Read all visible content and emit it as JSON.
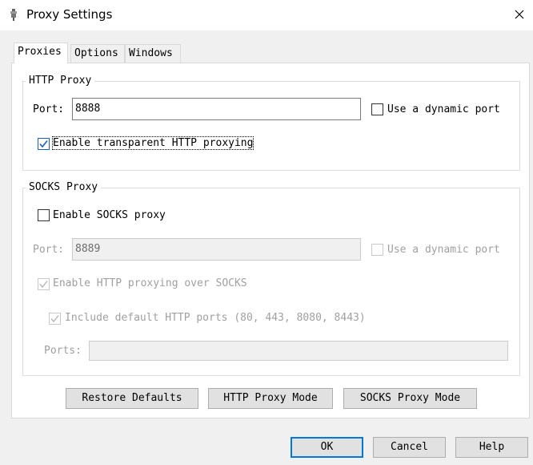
{
  "window": {
    "title": "Proxy Settings",
    "icon": "proxy-app-icon",
    "close_icon": "close-icon"
  },
  "tabs": [
    {
      "label": "Proxies",
      "active": true
    },
    {
      "label": "Options",
      "active": false
    },
    {
      "label": "Windows",
      "active": false
    }
  ],
  "http_proxy": {
    "group_label": "HTTP Proxy",
    "port_label": "Port:",
    "port_value": "8888",
    "dynamic_port_label": "Use a dynamic port",
    "dynamic_port_checked": false,
    "transparent_label": "Enable transparent HTTP proxying",
    "transparent_checked": true
  },
  "socks_proxy": {
    "group_label": "SOCKS Proxy",
    "enable_label": "Enable SOCKS proxy",
    "enable_checked": false,
    "port_label": "Port:",
    "port_value": "8889",
    "dynamic_port_label": "Use a dynamic port",
    "dynamic_port_checked": false,
    "http_over_socks_label": "Enable HTTP proxying over SOCKS",
    "http_over_socks_checked": true,
    "include_default_label": "Include default HTTP ports (80, 443, 8080, 8443)",
    "include_default_checked": true,
    "ports_label": "Ports:",
    "ports_value": ""
  },
  "panel_buttons": {
    "restore": "Restore Defaults",
    "http_mode": "HTTP Proxy Mode",
    "socks_mode": "SOCKS Proxy Mode"
  },
  "dialog_buttons": {
    "ok": "OK",
    "cancel": "Cancel",
    "help": "Help"
  },
  "colors": {
    "accent": "#0078d7",
    "check": "#1e5fb4",
    "disabled_text": "#a0a0a0"
  }
}
